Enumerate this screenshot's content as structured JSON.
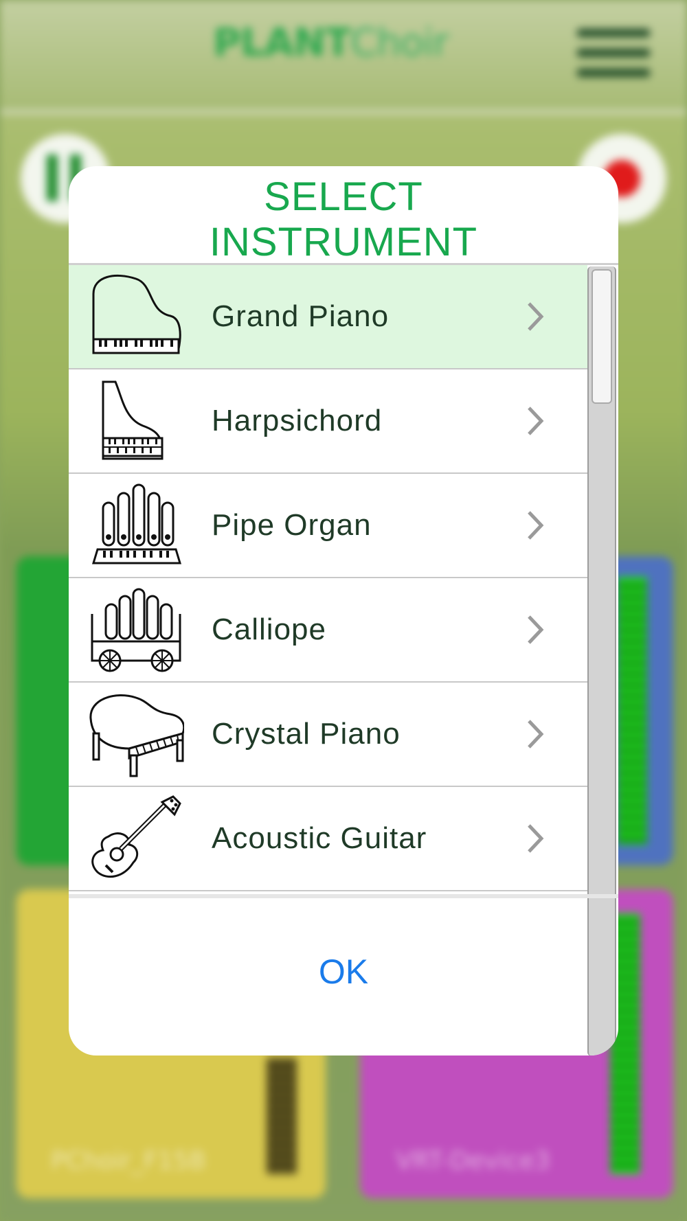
{
  "app": {
    "logo_bold": "PLANT",
    "logo_light": "Choir",
    "tiles": [
      {
        "label": "PChoir_F15B"
      },
      {
        "label": "VRT-Device3"
      }
    ]
  },
  "dialog": {
    "title_line1": "SELECT",
    "title_line2": "INSTRUMENT",
    "items": [
      {
        "label": "Grand Piano",
        "icon": "grand-piano-icon",
        "selected": true
      },
      {
        "label": "Harpsichord",
        "icon": "harpsichord-icon",
        "selected": false
      },
      {
        "label": "Pipe Organ",
        "icon": "pipe-organ-icon",
        "selected": false
      },
      {
        "label": "Calliope",
        "icon": "calliope-icon",
        "selected": false
      },
      {
        "label": "Crystal Piano",
        "icon": "crystal-piano-icon",
        "selected": false
      },
      {
        "label": "Acoustic Guitar",
        "icon": "acoustic-guitar-icon",
        "selected": false
      }
    ],
    "ok_label": "OK"
  },
  "colors": {
    "title": "#18a84e",
    "selected_row": "#def7df",
    "ok": "#1a7bea"
  }
}
